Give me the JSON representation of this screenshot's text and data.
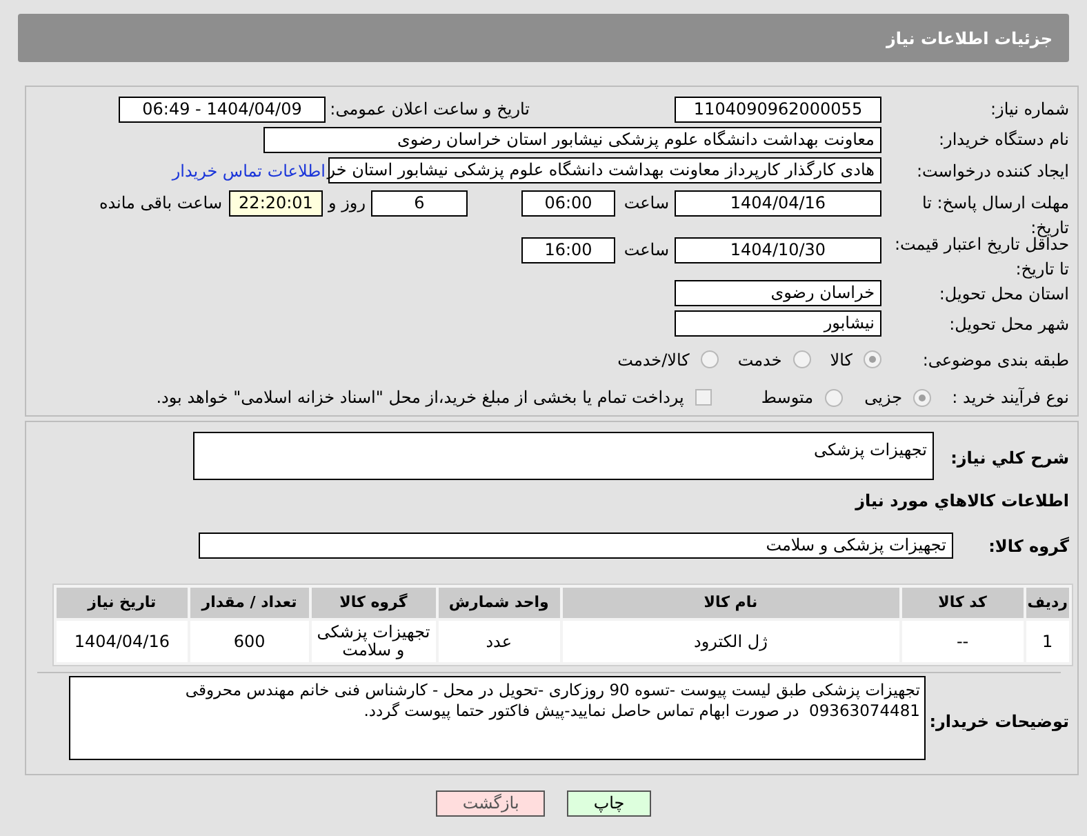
{
  "header": {
    "title": "جزئیات اطلاعات نیاز"
  },
  "need_number": {
    "label": "شماره نیاز:",
    "value": "1104090962000055"
  },
  "announce": {
    "label": "تاریخ و ساعت اعلان عمومی:",
    "value": "1404/04/09 - 06:49"
  },
  "buyer": {
    "label": "نام دستگاه خریدار:",
    "value": "معاونت بهداشت دانشگاه علوم پزشکی نیشابور استان خراسان رضوی"
  },
  "requester": {
    "label": "ایجاد کننده درخواست:",
    "value": "هادی کارگذار کارپرداز معاونت بهداشت دانشگاه علوم پزشکی نیشابور استان خر",
    "link": "اطلاعات تماس خریدار"
  },
  "deadline": {
    "label": "مهلت ارسال پاسخ: تا تاریخ:",
    "date": "1404/04/16",
    "time_label": "ساعت",
    "time": "06:00",
    "days": "6",
    "days_label": "روز و",
    "remaining": "22:20:01",
    "remaining_label": "ساعت باقی مانده"
  },
  "validity": {
    "label": "حداقل تاریخ اعتبار قیمت: تا تاریخ:",
    "date": "1404/10/30",
    "time_label": "ساعت",
    "time": "16:00"
  },
  "province": {
    "label": "استان محل تحویل:",
    "value": "خراسان رضوی"
  },
  "city": {
    "label": "شهر محل تحویل:",
    "value": "نیشابور"
  },
  "category": {
    "label": "طبقه بندی موضوعی:",
    "options": [
      {
        "label": "کالا",
        "selected": true
      },
      {
        "label": "خدمت",
        "selected": false
      },
      {
        "label": "کالا/خدمت",
        "selected": false
      }
    ]
  },
  "process": {
    "label": "نوع فرآیند خرید :",
    "options": [
      {
        "label": "جزیی",
        "selected": true
      },
      {
        "label": "متوسط",
        "selected": false
      }
    ],
    "payment": {
      "label": "پرداخت تمام یا بخشی از مبلغ خرید،از محل \"اسناد خزانه اسلامی\" خواهد بود.",
      "checked": false
    }
  },
  "description": {
    "label": "شرح کلي نياز:",
    "value": "تجهیزات پزشکی"
  },
  "goods_title": "اطلاعات کالاهاي مورد نياز",
  "goods_group": {
    "label": "گروه کالا:",
    "value": "تجهیزات پزشکی و سلامت"
  },
  "table": {
    "columns": [
      "ردیف",
      "کد کالا",
      "نام کالا",
      "واحد شمارش",
      "گروه کالا",
      "تعداد / مقدار",
      "تاریخ نیاز"
    ],
    "rows": [
      [
        "1",
        "--",
        "ژل الکترود",
        "عدد",
        "تجهیزات پزشکی و سلامت",
        "600",
        "1404/04/16"
      ]
    ]
  },
  "buyer_notes": {
    "label": "توضیحات خریدار:",
    "lines": [
      "تجهیزات پزشکی طبق لیست پیوست -تسوه 90 روزکاری -تحویل در محل - کارشناس فنی خانم مهندس محروقی",
      "09363074481  در صورت ابهام تماس حاصل نمایید-پیش فاکتور حتما پیوست گردد."
    ]
  },
  "buttons": [
    {
      "label": "چاپ",
      "kind": "print"
    },
    {
      "label": "بازگشت",
      "kind": "back"
    }
  ]
}
